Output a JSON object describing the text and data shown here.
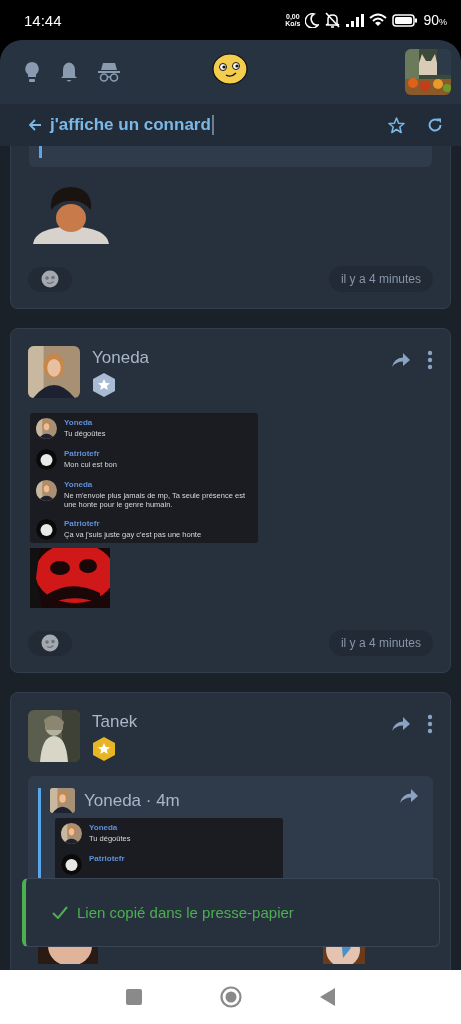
{
  "status_bar": {
    "time": "14:44",
    "net_speed": "0,00",
    "net_unit": "Ko/s",
    "battery": "90",
    "battery_unit": "%"
  },
  "title_bar": {
    "title": "j'affiche un connard",
    "starred": false
  },
  "posts": [
    {
      "kind": "cut",
      "time": "il y a 4 minutes"
    },
    {
      "kind": "full",
      "author": "Yoneda",
      "badge": {
        "color": "#a9bbd3"
      },
      "chat": {
        "messages": [
          {
            "author": "Yoneda",
            "text": "Tu dégoûtes"
          },
          {
            "kind": "ghost",
            "author": "Patriotefr",
            "text": "Mon cul est bon"
          },
          {
            "author": "Yoneda",
            "text": "Ne m'envoie plus jamais de mp, Ta seule présence est une honte pour le genre humain."
          },
          {
            "kind": "ghost",
            "author": "Patriotefr",
            "text": "Ça va j'suis juste gay c'est pas une honte"
          }
        ]
      },
      "time": "il y a 4 minutes"
    },
    {
      "kind": "full",
      "author": "Tanek",
      "badge": {
        "color": "#e8b624"
      },
      "quote": {
        "header": "Yoneda · 4m",
        "chat": {
          "messages": [
            {
              "author": "Yoneda",
              "text": "Tu dégoûtes"
            },
            {
              "kind": "ghost",
              "author": "Patriotefr"
            }
          ]
        }
      }
    }
  ],
  "toast": {
    "kind": "success",
    "text": "Lien copié dans le presse-papier"
  }
}
